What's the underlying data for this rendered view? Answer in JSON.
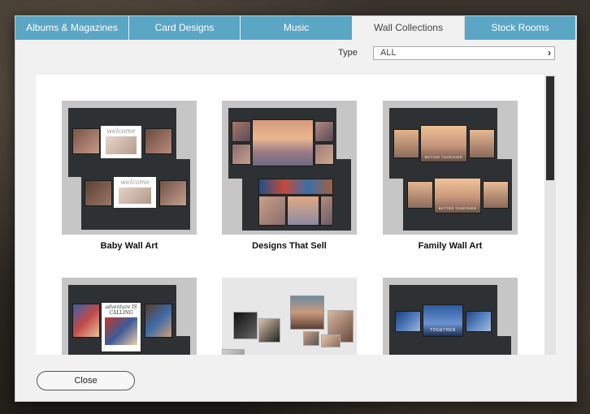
{
  "tabs": [
    {
      "label": "Albums & Magazines"
    },
    {
      "label": "Card Designs"
    },
    {
      "label": "Music"
    },
    {
      "label": "Wall Collections"
    },
    {
      "label": "Stock Rooms"
    }
  ],
  "filter": {
    "label": "Type",
    "value": "ALL"
  },
  "collections": [
    {
      "title": "Baby Wall Art",
      "photo_caption": "welcome"
    },
    {
      "title": "Designs That Sell"
    },
    {
      "title": "Family Wall Art",
      "photo_caption": "BETTER TOGETHER"
    },
    {
      "photo_caption": "adventure IS CALLING"
    },
    {},
    {
      "photo_caption": "TOGETHER"
    }
  ],
  "buttons": {
    "close": "Close"
  },
  "colors": {
    "tab": "#5aa6c4",
    "tab_text": "#ffffff",
    "dialog_bg": "#f1f1f1",
    "panel": "#2d3133"
  }
}
